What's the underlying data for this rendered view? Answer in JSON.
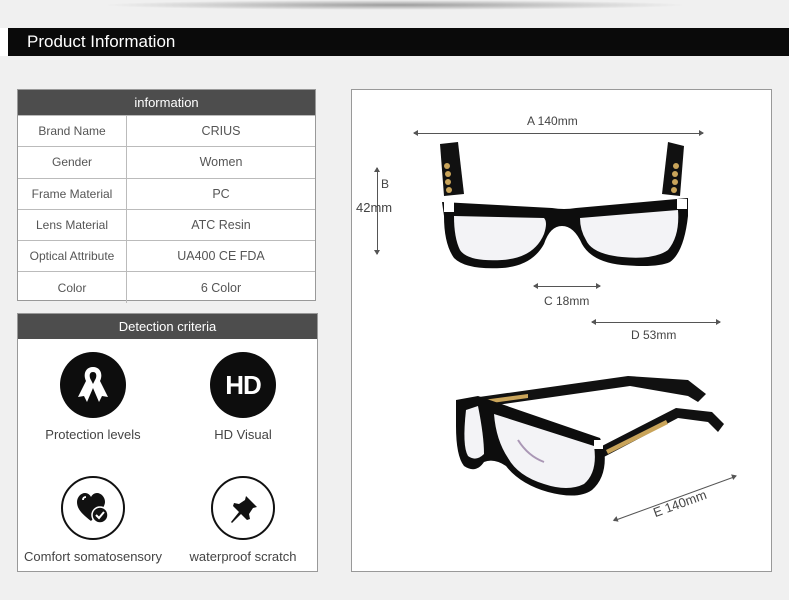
{
  "header": {
    "title": "Product Information"
  },
  "info_table": {
    "heading": "information",
    "rows": [
      {
        "key": "Brand Name",
        "value": "CRIUS"
      },
      {
        "key": "Gender",
        "value": "Women"
      },
      {
        "key": "Frame Material",
        "value": "PC"
      },
      {
        "key": "Lens Material",
        "value": "ATC Resin"
      },
      {
        "key": "Optical Attribute",
        "value": "UA400 CE FDA"
      },
      {
        "key": "Color",
        "value": "6 Color"
      }
    ]
  },
  "detection": {
    "heading": "Detection criteria",
    "features": [
      {
        "label": "Protection levels",
        "icon": "ribbon-icon"
      },
      {
        "label": "HD Visual",
        "icon": "hd-icon",
        "icon_text": "HD"
      },
      {
        "label": "Comfort somatosensory",
        "icon": "heart-check-icon"
      },
      {
        "label": "waterproof scratch",
        "icon": "pin-icon"
      }
    ]
  },
  "dimensions": {
    "a": "A 140mm",
    "b_letter": "B",
    "b_value": "42mm",
    "c": "C 18mm",
    "d": "D 53mm",
    "e": "E 140mm"
  }
}
